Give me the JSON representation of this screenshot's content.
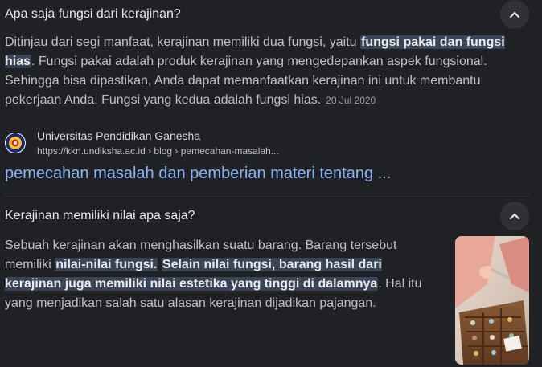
{
  "q1": {
    "question": "Apa saja fungsi dari kerajinan?",
    "answer_before": "Ditinjau dari segi manfaat, kerajinan memiliki dua fungsi, yaitu ",
    "answer_highlight": "fungsi pakai dan fungsi hias",
    "answer_after": ". Fungsi pakai adalah produk kerajinan yang mengedepankan aspek fungsional. Sehingga bisa dipastikan, Anda dapat memanfaatkan kerajinan ini untuk membantu pekerjaan Anda. Fungsi yang kedua adalah fungsi hias.",
    "date": "20 Jul 2020",
    "source_name": "Universitas Pendidikan Ganesha",
    "source_url": "https://kkn.undiksha.ac.id › blog › pemecahan-masalah...",
    "link_title": "pemecahan masalah dan pemberian materi tentang ..."
  },
  "q2": {
    "question": "Kerajinan memiliki nilai apa saja?",
    "answer_before": "Sebuah kerajinan akan menghasilkan suatu barang. Barang tersebut memiliki ",
    "answer_highlight1": "nilai-nilai fungsi.",
    "answer_between": " ",
    "answer_highlight2": "Selain nilai fungsi, barang hasil dari kerajinan juga memiliki nilai estetika yang tinggi di dalamnya",
    "answer_after": ". Hal itu yang menjadikan salah satu alasan kerajinan dijadikan pajangan."
  },
  "icons": {
    "collapse": "chevron-up-icon",
    "favicon": "university-logo-icon",
    "thumbnail": "craft-photo-thumbnail"
  },
  "colors": {
    "background": "#202124",
    "link": "#8ab4f8",
    "highlight": "#394457"
  }
}
